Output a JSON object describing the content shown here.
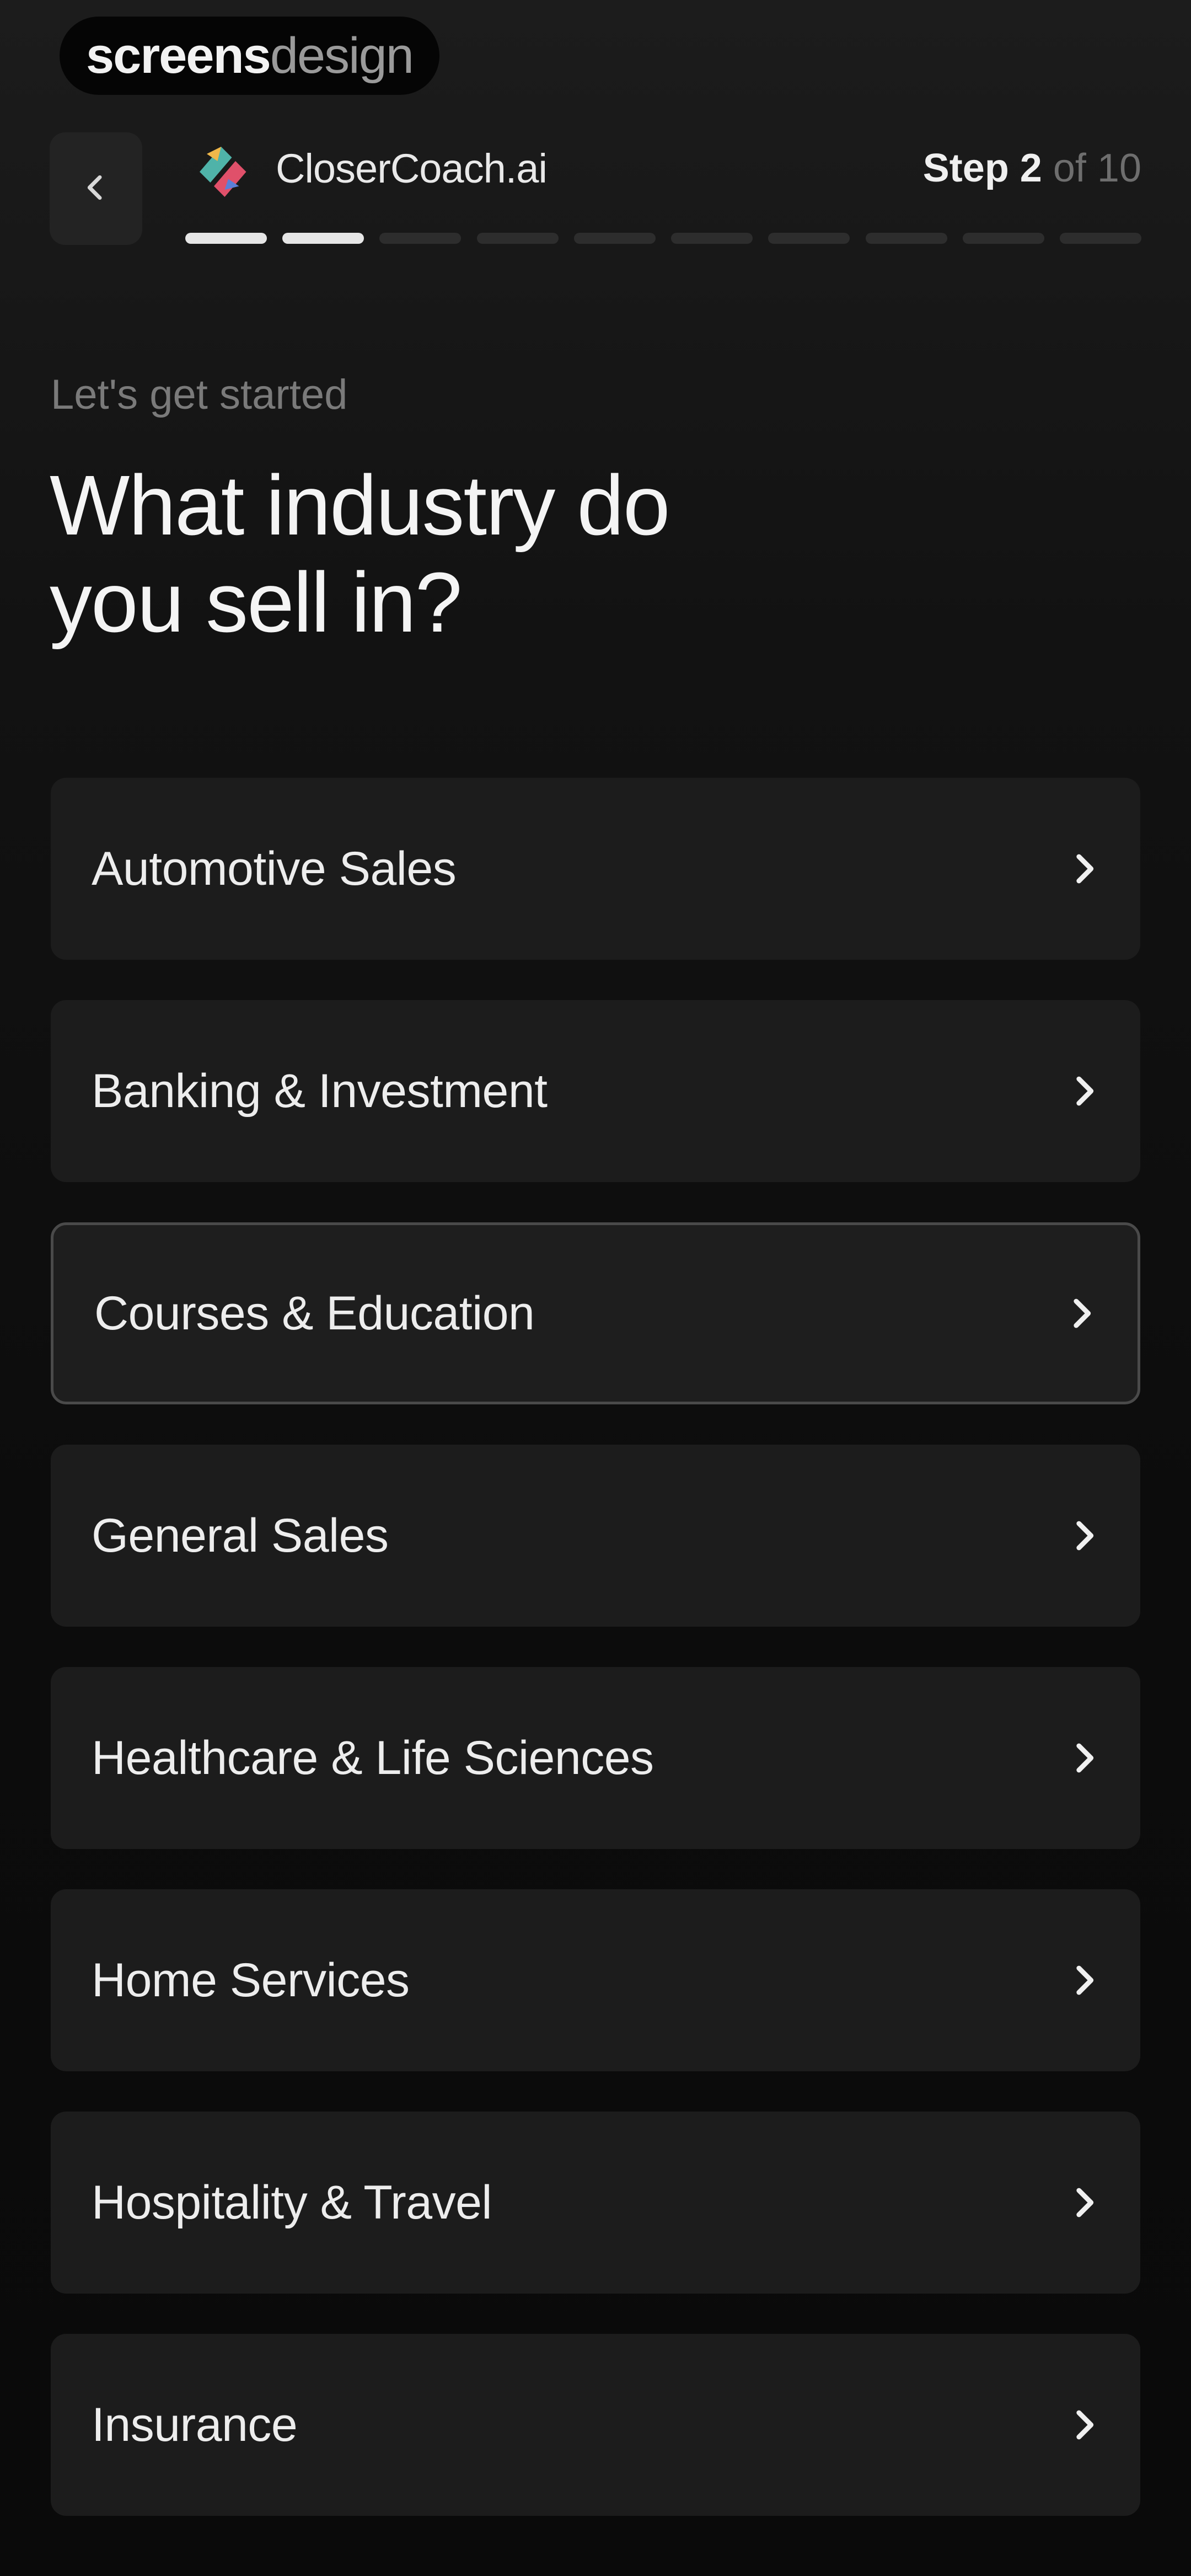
{
  "watermark": {
    "part_a": "screens",
    "part_b": "design"
  },
  "header": {
    "brand_name": "CloserCoach.ai",
    "step_label": "Step 2",
    "step_total": "of 10",
    "progress": {
      "current": 2,
      "total": 10
    }
  },
  "content": {
    "eyebrow": "Let's get started",
    "title_line1": "What industry do",
    "title_line2": "you sell in?"
  },
  "options": [
    {
      "label": "Automotive Sales",
      "selected": false
    },
    {
      "label": "Banking & Investment",
      "selected": false
    },
    {
      "label": "Courses & Education",
      "selected": true
    },
    {
      "label": "General Sales",
      "selected": false
    },
    {
      "label": "Healthcare & Life Sciences",
      "selected": false
    },
    {
      "label": "Home Services",
      "selected": false
    },
    {
      "label": "Hospitality & Travel",
      "selected": false
    },
    {
      "label": "Insurance",
      "selected": false
    }
  ],
  "icons": {
    "back": "chevron-left-icon",
    "option": "chevron-right-icon",
    "brand": "closercoach-logo"
  },
  "colors": {
    "background": "#0e0e0e",
    "card": "#1c1c1c",
    "selected_border": "#4a4a4a",
    "progress_done": "#e6e6e6",
    "progress_todo": "#2d2d2d"
  }
}
